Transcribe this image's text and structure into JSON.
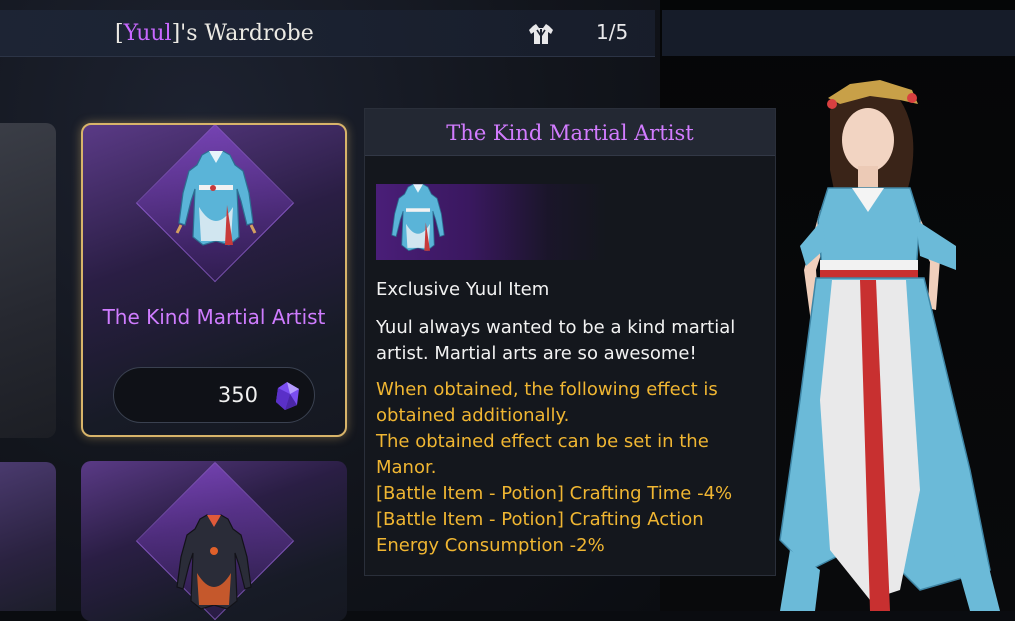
{
  "header": {
    "title_prefix": "[",
    "title_name": "Yuul",
    "title_suffix": "]'s Wardrobe",
    "wardrobe_icon": "outfit-icon",
    "page_count": "1/5"
  },
  "cards": [
    {
      "name": "The Kind Martial Artist",
      "price": "350",
      "currency_icon": "purple-gem-icon",
      "selected": true,
      "outfit_colors": {
        "main": "#5ab4d8",
        "accent": "#c83a3a"
      }
    },
    {
      "name": "",
      "selected": false,
      "outfit_colors": {
        "main": "#2a2c38",
        "accent": "#e0602a"
      }
    }
  ],
  "tooltip": {
    "title": "The Kind Martial Artist",
    "exclusive": "Exclusive Yuul Item",
    "description": [
      "Yuul always wanted to be a kind martial",
      "artist. Martial arts are so awesome!"
    ],
    "effect": [
      "When obtained, the following effect is",
      "obtained additionally.",
      "The obtained effect can be set in the",
      "Manor.",
      "[Battle Item - Potion] Crafting Time -4%",
      "[Battle Item - Potion] Crafting Action",
      "Energy Consumption -2%"
    ]
  },
  "colors": {
    "rarity_purple": "#cf7cff",
    "effect_gold": "#f0b632",
    "selected_border": "#d8b46a"
  }
}
